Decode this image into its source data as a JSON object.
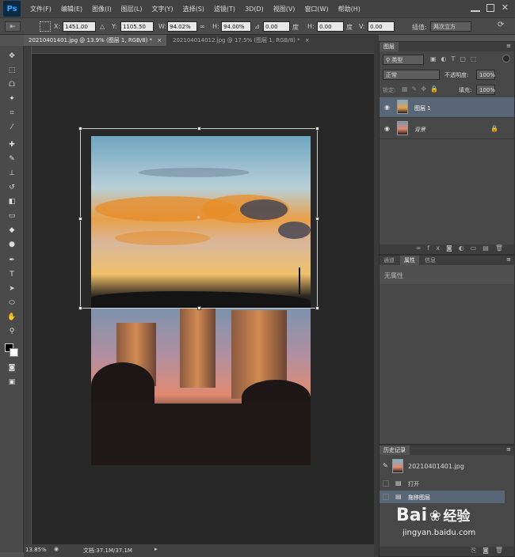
{
  "app": {
    "logo": "Ps"
  },
  "menu": [
    "文件(F)",
    "编辑(E)",
    "图像(I)",
    "图层(L)",
    "文字(Y)",
    "选择(S)",
    "滤镜(T)",
    "3D(D)",
    "视图(V)",
    "窗口(W)",
    "帮助(H)"
  ],
  "options": {
    "x_label": "X:",
    "x_value": "1451.00 像",
    "y_label": "Y:",
    "y_value": "1105.50 像",
    "w_label": "W:",
    "w_value": "94.02%",
    "h_label": "H:",
    "h_value": "94.00%",
    "angle_value": "0.00",
    "angle_unit": "度",
    "hskew_label": "H:",
    "hskew_value": "0.00",
    "hskew_unit": "度",
    "vskew_label": "V:",
    "vskew_value": "0.00",
    "interp_label": "插值:",
    "interp_value": "两次立方"
  },
  "tabs": [
    {
      "label": "20210401401.jpg @ 13.9% (图层 1, RGB/8) *",
      "active": true
    },
    {
      "label": "20210401401​2.jpg @ 17.5% (图层 1, RGB/8) *",
      "active": false
    }
  ],
  "status": {
    "zoom": "13.85%",
    "doc": "文档:37.1M/37.1M"
  },
  "layers_panel": {
    "title": "图层",
    "filter_label": "类型",
    "blend_mode": "正常",
    "opacity_label": "不透明度:",
    "opacity_value": "100%",
    "lock_label": "锁定:",
    "fill_label": "填充:",
    "fill_value": "100%",
    "layers": [
      {
        "name": "图层 1",
        "selected": true
      },
      {
        "name": "背景",
        "selected": false
      }
    ]
  },
  "properties_panel": {
    "tabs": [
      "通道",
      "属性",
      "信息"
    ],
    "content": "无属性"
  },
  "history_panel": {
    "title": "历史记录",
    "snapshot": "20210401401.jpg",
    "items": [
      "打开",
      "拖移图层"
    ]
  },
  "watermark": {
    "brand": "Bai",
    "brand2": "经验",
    "url": "jingyan.baidu.com"
  },
  "colors": {
    "accent": "#31a8ff",
    "selected_row": "#596678"
  }
}
